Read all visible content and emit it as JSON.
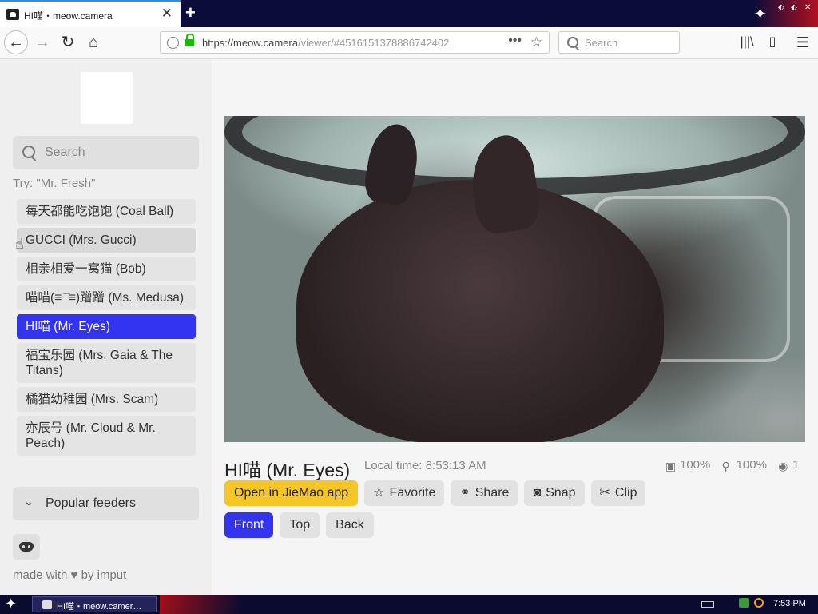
{
  "browser": {
    "tab_title": "HI喵・meow.camera",
    "tab_close": "✕",
    "new_tab": "+",
    "url_host": "https://meow.camera",
    "url_path": "/viewer/#4516151378886742402",
    "url_info": "i",
    "url_dots": "•••",
    "url_star": "☆",
    "search_placeholder": "Search",
    "nav_back": "←",
    "nav_forward": "→",
    "nav_reload": "↻",
    "nav_home": "⌂",
    "library": "|||\\",
    "sidebar_toggle": "▯",
    "menu": "☰",
    "window_star": "✦",
    "window_controls": [
      "⬖",
      "⬖",
      "✕"
    ]
  },
  "sidebar": {
    "search_placeholder": "Search",
    "try_hint": "Try: \"Mr. Fresh\"",
    "cameras": [
      {
        "label": "每天都能吃饱饱 (Coal Ball)"
      },
      {
        "label": "GUCCI (Mrs. Gucci)"
      },
      {
        "label": "相亲相爱一窝猫 (Bob)"
      },
      {
        "label": "喵喵(≡ ̄ ̄≡)蹭蹭 (Ms. Medusa)"
      },
      {
        "label": "HI喵 (Mr. Eyes)"
      },
      {
        "label": "福宝乐园 (Mrs. Gaia & The Titans)"
      },
      {
        "label": "橘猫幼稚园 (Mrs. Scam)"
      },
      {
        "label": "亦辰号 (Mr. Cloud & Mr. Peach)"
      }
    ],
    "selected_index": 4,
    "popular_label": "Popular feeders",
    "popular_chevron": "⌄",
    "credit_prefix": "made with",
    "credit_heart": "♥",
    "credit_by": "by",
    "credit_author": "imput",
    "cursor": "☝"
  },
  "viewer": {
    "cam_title": "HI喵 (Mr. Eyes)",
    "local_time": "Local time: 8:53:13 AM",
    "food_level": "100%",
    "food_icon": "food-storage-icon",
    "food_glyph": "▣",
    "treat_level": "100%",
    "treat_icon": "bone-icon",
    "treat_glyph": "⚲",
    "viewers": "1",
    "viewers_icon": "eye-icon",
    "viewers_glyph": "◉",
    "buttons": {
      "open_app": "Open in JieMao app",
      "favorite": "Favorite",
      "favorite_icon": "☆",
      "share": "Share",
      "share_icon": "⚭",
      "snap": "Snap",
      "snap_icon": "◙",
      "clip": "Clip",
      "clip_icon": "✂"
    },
    "views": [
      {
        "label": "Front"
      },
      {
        "label": "Top"
      },
      {
        "label": "Back"
      }
    ],
    "active_view": 0
  },
  "taskbar": {
    "start_icon": "✦",
    "task_label": "HI喵・meow.camer…",
    "clock": "7:53 PM"
  },
  "colors": {
    "accent_blue": "#3333f2",
    "primary_yellow": "#f6c626",
    "lock_green": "#12bc00"
  }
}
